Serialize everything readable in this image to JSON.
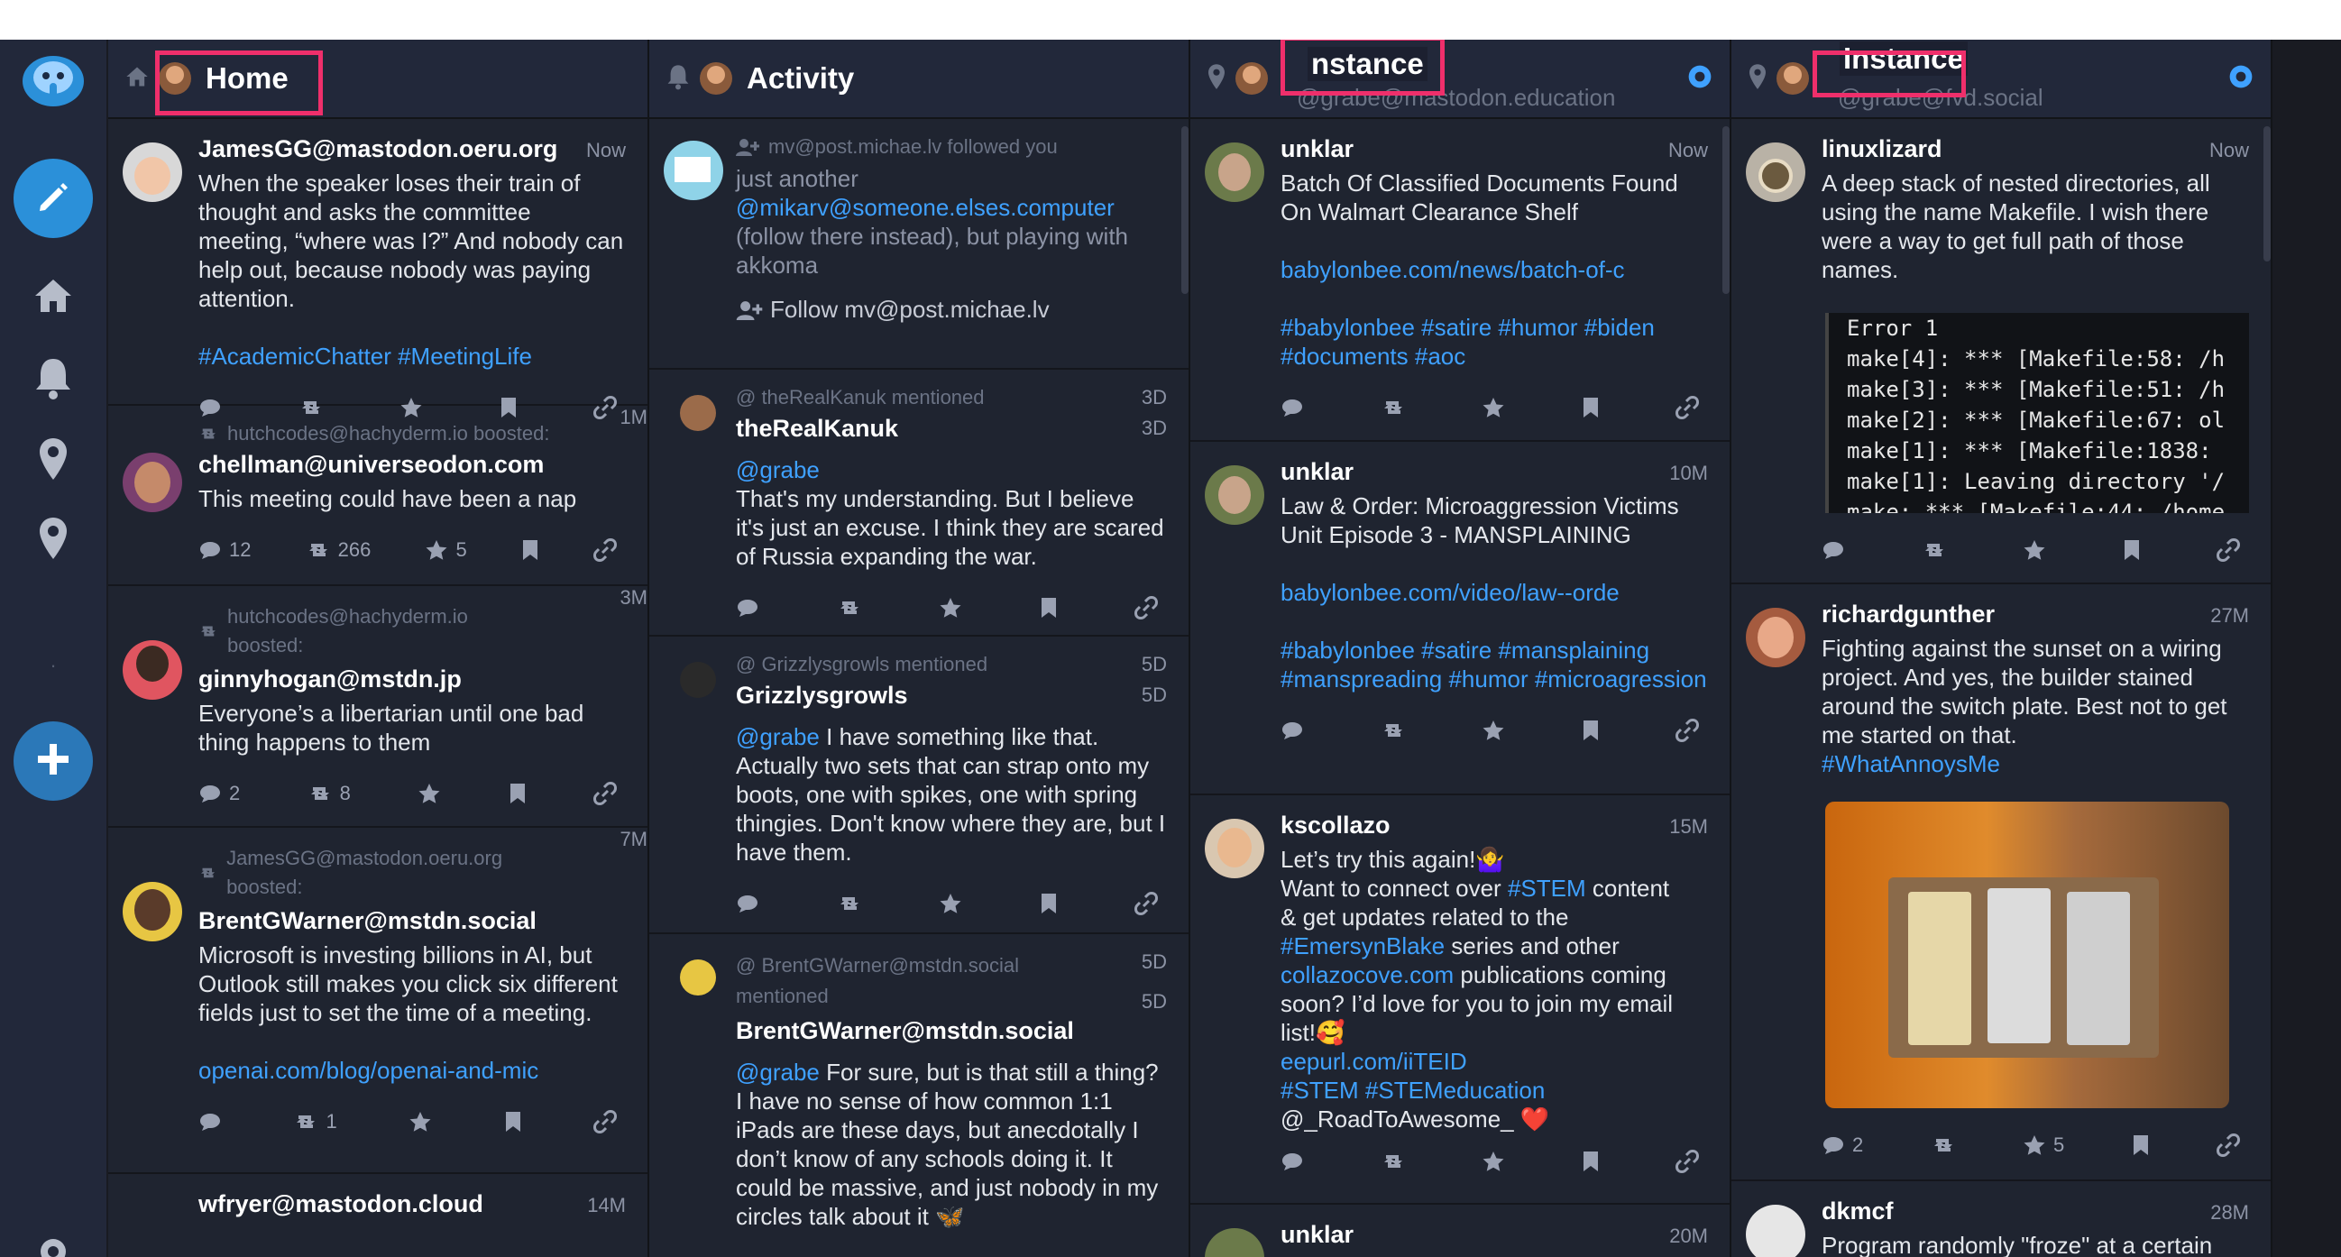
{
  "colors": {
    "accent": "#3fa1ff",
    "highlight": "#ef2f6b",
    "background": "#191b22",
    "column": "#1f2430",
    "header": "#22283a"
  },
  "nav": {
    "items": [
      {
        "name": "mastodon-logo",
        "icon": "elephant-icon"
      },
      {
        "name": "compose-button",
        "icon": "pencil-icon"
      },
      {
        "name": "home",
        "icon": "home-icon"
      },
      {
        "name": "notifications",
        "icon": "bell-icon"
      },
      {
        "name": "instance-1",
        "icon": "map-pin-icon"
      },
      {
        "name": "instance-2",
        "icon": "map-pin-icon"
      },
      {
        "name": "add-column",
        "icon": "plus-icon"
      },
      {
        "name": "settings",
        "icon": "gear-icon"
      }
    ],
    "separator": "."
  },
  "columns": [
    {
      "title": "Home",
      "icon": "home-icon",
      "statuses": [
        {
          "boost": "",
          "author": "JamesGG@mastodon.oeru.org",
          "time": "Now",
          "text": "When the speaker loses their train of thought and asks the committee meeting, “where was I?” And nobody can help out, because nobody was paying attention.",
          "link": "",
          "tags": "#AcademicChatter #MeetingLife",
          "replies": "",
          "boosts": "",
          "favs": ""
        },
        {
          "boost": "hutchcodes@hachyderm.io boosted:",
          "author": "chellman@universeodon.com",
          "time": "1M",
          "text": "This meeting could have been a nap",
          "link": "",
          "tags": "",
          "replies": "12",
          "boosts": "266",
          "favs": "5"
        },
        {
          "boost": "hutchcodes@hachyderm.io boosted:",
          "author": "ginnyhogan@mstdn.jp",
          "time": "3M",
          "text": "Everyone’s a libertarian until one bad thing happens to them",
          "link": "",
          "tags": "",
          "replies": "2",
          "boosts": "8",
          "favs": ""
        },
        {
          "boost": "JamesGG@mastodon.oeru.org boosted:",
          "author": "BrentGWarner@mstdn.social",
          "time": "7M",
          "text": "Microsoft is investing billions in AI, but Outlook still makes you click six different fields just to set the time of a meeting.",
          "link": "openai.com/blog/openai-and-mic",
          "tags": "",
          "replies": "",
          "boosts": "1",
          "favs": ""
        },
        {
          "boost": "",
          "author": "wfryer@mastodon.cloud",
          "time": "14M",
          "text": "",
          "link": "",
          "tags": "",
          "replies": "",
          "boosts": "",
          "favs": ""
        }
      ]
    },
    {
      "title": "Activity",
      "icon": "bell-icon",
      "follow": {
        "line": "mv@post.michae.lv followed you",
        "text1": "just another",
        "mention": "@mikarv@someone.elses.computer",
        "text2": "(follow there instead), but playing with akkoma",
        "button": "Follow mv@post.michae.lv"
      },
      "mentions": [
        {
          "header": "@ theRealKanuk mentioned",
          "author": "theRealKanuk",
          "time": "3D",
          "time2": "3D",
          "mention": "@grabe",
          "text": "That's my understanding. But I believe it's just an excuse. I think they are scared of Russia expanding the war."
        },
        {
          "header": "@ Grizzlysgrowls mentioned",
          "author": "Grizzlysgrowls",
          "time": "5D",
          "time2": "5D",
          "mention": "@grabe",
          "text": " I have something like that. Actually two sets that can strap onto my boots, one with spikes, one with spring thingies. Don't know where they are, but I have them."
        },
        {
          "header": "@ BrentGWarner@mstdn.social mentioned",
          "author": "BrentGWarner@mstdn.social",
          "time": "5D",
          "time2": "5D",
          "mention": "@grabe",
          "text": " For sure, but is that still a thing? I have no sense of how common 1:1 iPads are these days, but anecdotally I don’t know of any schools doing it. It could be massive, and just nobody in my circles talk about it 🦋"
        }
      ]
    },
    {
      "title": "nstance",
      "subtitle": "@grabe@mastodon.education",
      "icon": "map-pin-icon",
      "statuses": [
        {
          "author": "unklar",
          "time": "Now",
          "text": "Batch Of Classified Documents Found On Walmart Clearance Shelf",
          "link": "babylonbee.com/news/batch-of-c",
          "tags": "#babylonbee #satire #humor #biden #documents #aoc"
        },
        {
          "author": "unklar",
          "time": "10M",
          "text": "Law & Order: Microaggression Victims Unit Episode 3 - MANSPLAINING",
          "link": "babylonbee.com/video/law--orde",
          "tags": "#babylonbee #satire #mansplaining #manspreading #humor #microagression"
        },
        {
          "author": "kscollazo",
          "time": "15M",
          "text": "",
          "link": "",
          "tags": ""
        },
        {
          "author": "unklar",
          "time": "20M",
          "text": "",
          "link": "",
          "tags": ""
        }
      ],
      "kscollazo": {
        "l1": "Let’s try this again!🤷‍♀️",
        "l2a": "Want to connect over ",
        "l2b": "#STEM",
        "l2c": " content",
        "l3": "& get updates related to the",
        "l4a": "#EmersynBlake",
        "l4b": " series and other",
        "l5a": "collazocove.com",
        "l5b": " publications coming",
        "l6": "soon? I’d love for you to join my email",
        "l7": "list!🥰",
        "l8": "eepurl.com/iiTEID",
        "l9": "#STEM #STEMeducation",
        "l10": "@_RoadToAwesome_ ❤️"
      }
    },
    {
      "title": "Instance",
      "subtitle": "@grabe@fvd.social",
      "icon": "map-pin-icon",
      "statuses": [
        {
          "author": "linuxlizard",
          "time": "Now",
          "text": "A deep stack of nested directories, all using the name Makefile. I wish there were a way to get full path of those names.",
          "code": "Error 1\nmake[4]: *** [Makefile:58: /h\nmake[3]: *** [Makefile:51: /h\nmake[2]: *** [Makefile:67: ol\nmake[1]: *** [Makefile:1838:\nmake[1]: Leaving directory '/\nmake: *** [Makefile:44: /home"
        },
        {
          "author": "richardgunther",
          "time": "27M",
          "text": "Fighting against the sunset on a wiring project. And yes, the builder stained around the switch plate. Best not to get me started on that.",
          "tag": "#WhatAnnoysMe",
          "replies": "2",
          "favs": "5"
        },
        {
          "author": "dkmcf",
          "time": "28M",
          "text": "Program randomly \"froze\" at a certain"
        }
      ]
    }
  ]
}
